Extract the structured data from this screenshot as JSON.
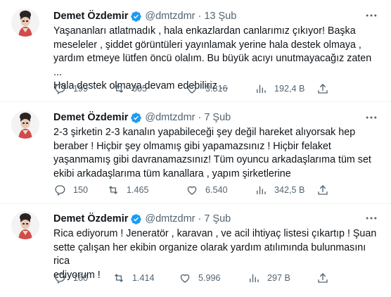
{
  "tweets": [
    {
      "author": "Demet Özdemir",
      "handle": "@dmtzdmr",
      "separator": "·",
      "date": "13 Şub",
      "text": "Yaşananları atlatmadık , hala enkazlardan canlarımız çıkıyor! Başka\nmeseleler , şiddet görüntüleri yayınlamak yerine hala destek olmaya ,\nyardım etmeye lütfen öncü olalım. Bu büyük acıyı unutmayacağız zaten ...\nHala destek olmaya devam edebiliriz ...",
      "replies": "199",
      "retweets": "605",
      "likes": "3.816",
      "views": "192,4 B"
    },
    {
      "author": "Demet Özdemir",
      "handle": "@dmtzdmr",
      "separator": "·",
      "date": "7 Şub",
      "text": "2-3 şirketin 2-3 kanalın yapabileceği şey değil hareket alıyorsak hep\nberaber ! Hiçbir şey olmamış gibi yapamazsınız ! Hiçbir felaket\nyaşanmamış gibi davranamazsınız! Tüm oyuncu arkadaşlarıma tüm set\nekibi arkadaşlarıma tüm kanallara , yapım şirketlerine",
      "replies": "150",
      "retweets": "1.465",
      "likes": "6.540",
      "views": "342,5 B"
    },
    {
      "author": "Demet Özdemir",
      "handle": "@dmtzdmr",
      "separator": "·",
      "date": "7 Şub",
      "text": "Rica ediyorum ! Jeneratör , karavan , ve acil ihtiyaç listesi çıkartıp ! Şuan\nsette çalışan her ekibin organize olarak yardım atılımında bulunmasını rica\nediyorum !",
      "replies": "160",
      "retweets": "1.414",
      "likes": "5.996",
      "views": "297 B"
    }
  ],
  "icons": {
    "verified": "verified-badge-icon",
    "more": "more-icon",
    "reply": "reply-icon",
    "retweet": "retweet-icon",
    "like": "like-icon",
    "views": "views-icon",
    "share": "share-icon"
  },
  "colors": {
    "verified": "#1d9bf0",
    "text": "#0f1419",
    "muted": "#536471",
    "divider": "#eff3f4"
  }
}
